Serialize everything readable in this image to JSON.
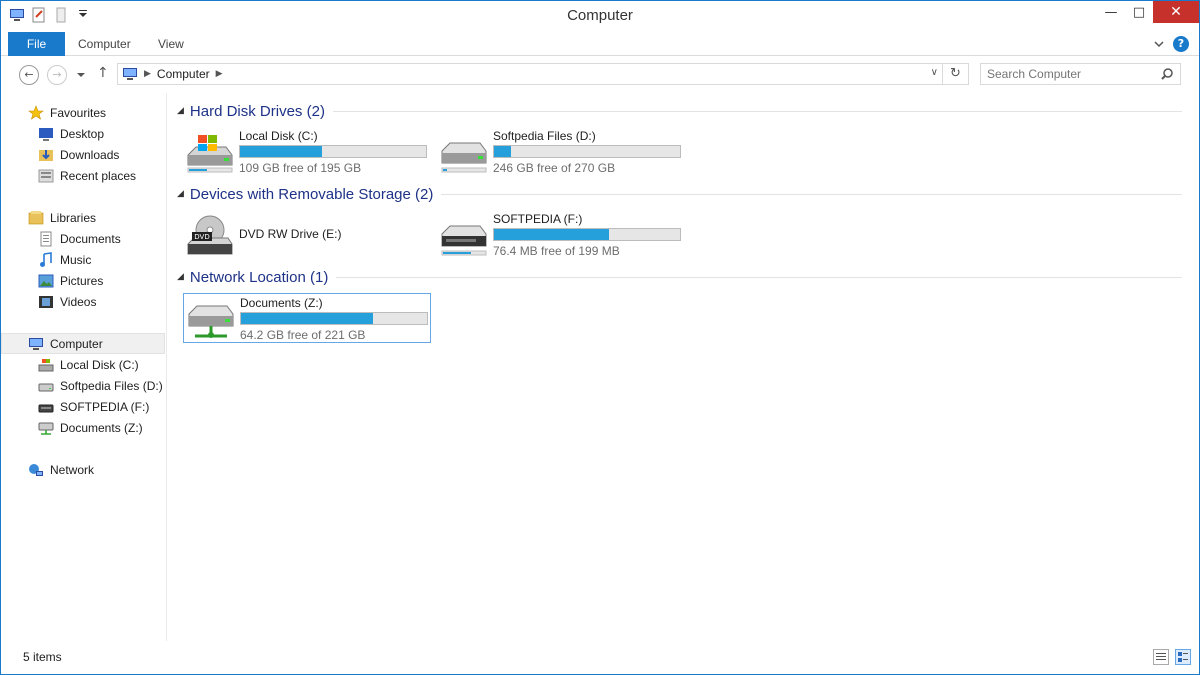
{
  "window": {
    "title": "Computer"
  },
  "ribbon": {
    "tabs": [
      "File",
      "Computer",
      "View"
    ]
  },
  "nav": {
    "address": "Computer",
    "search_placeholder": "Search Computer"
  },
  "sidebar": {
    "favourites": "Favourites",
    "desktop": "Desktop",
    "downloads": "Downloads",
    "recent": "Recent places",
    "libraries": "Libraries",
    "documents": "Documents",
    "music": "Music",
    "pictures": "Pictures",
    "videos": "Videos",
    "computer": "Computer",
    "local_disk": "Local Disk (C:)",
    "softpedia_files": "Softpedia Files (D:)",
    "softpedia_f": "SOFTPEDIA (F:)",
    "documents_z": "Documents (Z:)",
    "network": "Network"
  },
  "groups": {
    "hdd": "Hard Disk Drives (2)",
    "removable": "Devices with Removable Storage (2)",
    "network": "Network Location (1)"
  },
  "drives": {
    "c": {
      "name": "Local Disk (C:)",
      "free": "109 GB free of 195 GB",
      "used_fraction": 0.44
    },
    "d": {
      "name": "Softpedia Files (D:)",
      "free": "246 GB free of 270 GB",
      "used_fraction": 0.09
    },
    "e": {
      "name": "DVD RW Drive (E:)"
    },
    "f": {
      "name": "SOFTPEDIA (F:)",
      "free": "76.4 MB free of 199 MB",
      "used_fraction": 0.62
    },
    "z": {
      "name": "Documents (Z:)",
      "free": "64.2 GB free of 221 GB",
      "used_fraction": 0.71
    }
  },
  "status": {
    "items": "5 items"
  },
  "icons": {
    "dvd_label": "DVD",
    "help": "?"
  },
  "colors": {
    "accent": "#1979ca",
    "bar_fill": "#26a0da",
    "close": "#c7312b",
    "group_heading": "#1e3287"
  }
}
